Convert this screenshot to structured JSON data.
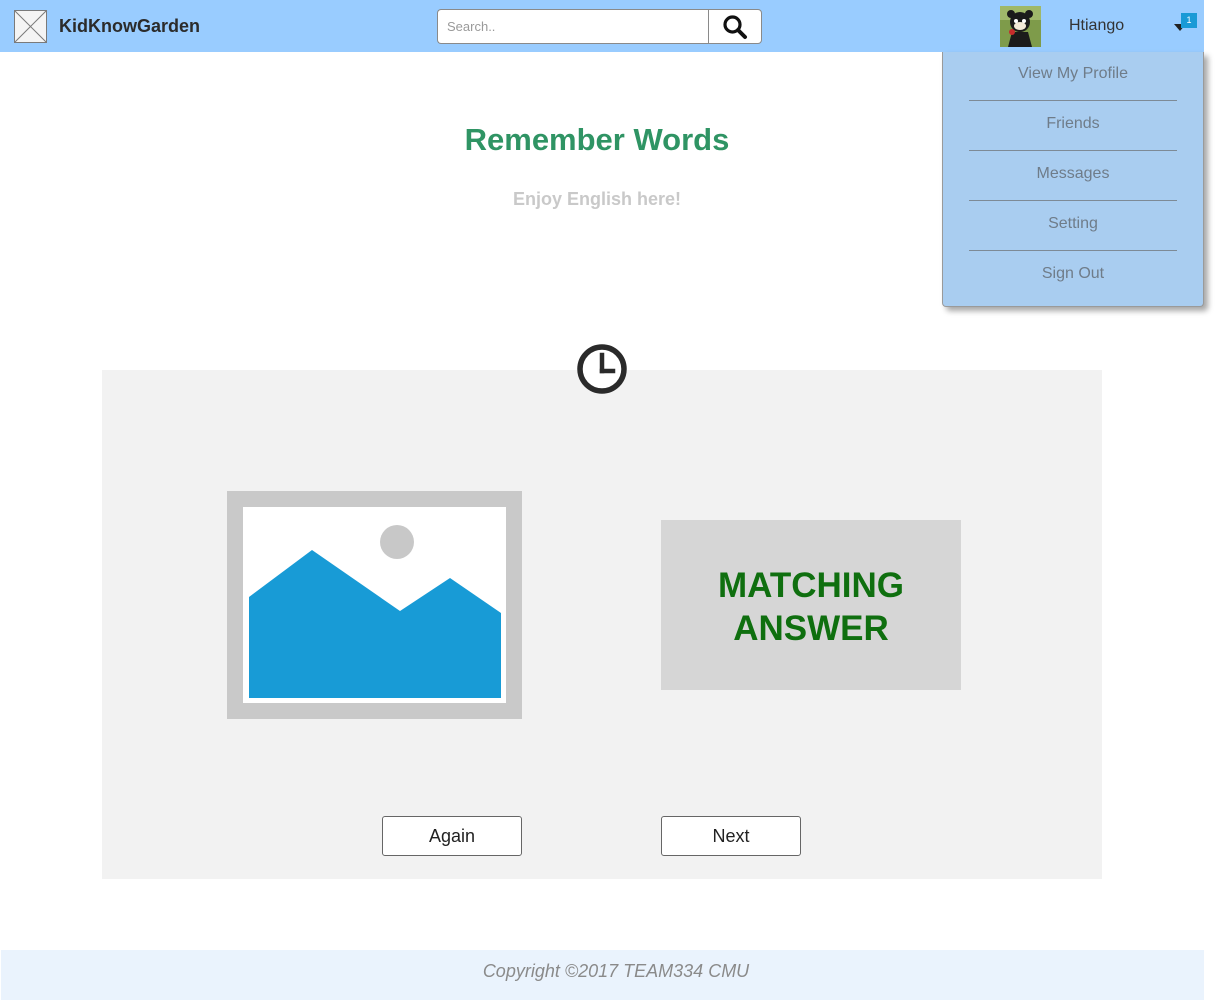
{
  "header": {
    "brand": "KidKnowGarden",
    "search": {
      "placeholder": "Search..",
      "value": ""
    },
    "user": {
      "name": "Htiango",
      "notification_count": "1"
    }
  },
  "user_menu": {
    "items": [
      {
        "label": "View My Profile"
      },
      {
        "label": "Friends"
      },
      {
        "label": "Messages"
      },
      {
        "label": "Setting"
      },
      {
        "label": "Sign Out"
      }
    ]
  },
  "main": {
    "title": "Remember Words",
    "subtitle": "Enjoy English here!",
    "answer_text": "MATCHING\nANSWER",
    "again_label": "Again",
    "next_label": "Next"
  },
  "footer": {
    "copyright": "Copyright ©2017 TEAM334 CMU"
  },
  "icons": {
    "logo": "image-placeholder-icon",
    "search": "search-icon",
    "caret": "caret-down-icon",
    "timer": "clock-icon",
    "picture": "image-placeholder-icon"
  },
  "colors": {
    "topbar": "#99ccff",
    "dropdown": "#a9cdf0",
    "title": "#2f9464",
    "answer": "#0f6f0f",
    "panel": "#f2f2f2",
    "footer": "#eaf3fd",
    "badge": "#1a9ad6",
    "image_mountains": "#189bd6"
  }
}
